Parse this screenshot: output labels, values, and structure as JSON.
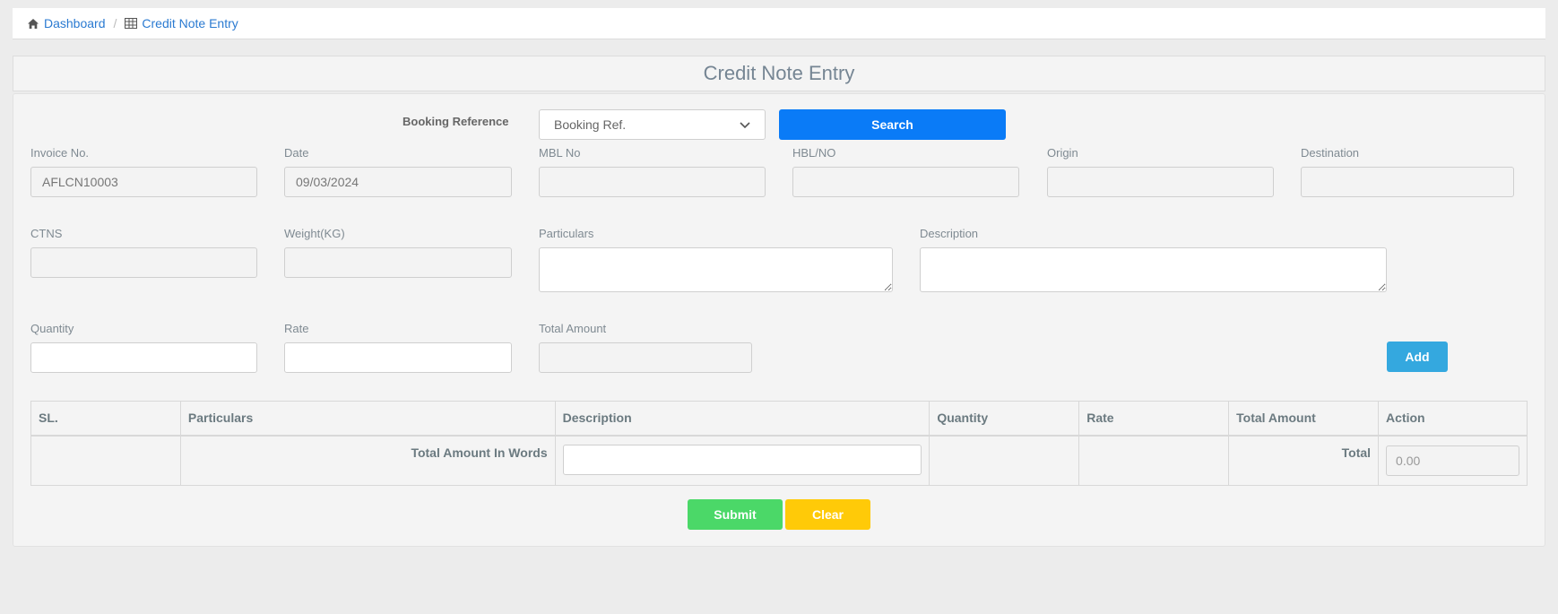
{
  "breadcrumb": {
    "home_label": "Dashboard",
    "home_icon": "home-icon",
    "current_label": "Credit Note Entry",
    "current_icon": "table-icon"
  },
  "page": {
    "title": "Credit Note Entry"
  },
  "form": {
    "booking_reference_label": "Booking Reference",
    "booking_reference_value": "Booking Ref.",
    "search_label": "Search",
    "invoice_no_label": "Invoice No.",
    "invoice_no_value": "AFLCN10003",
    "date_label": "Date",
    "date_value": "09/03/2024",
    "mbl_label": "MBL No",
    "hbl_label": "HBL/NO",
    "origin_label": "Origin",
    "destination_label": "Destination",
    "ctns_label": "CTNS",
    "weight_label": "Weight(KG)",
    "particulars_label": "Particulars",
    "description_label": "Description",
    "quantity_label": "Quantity",
    "rate_label": "Rate",
    "total_amount_label": "Total Amount",
    "add_label": "Add"
  },
  "table": {
    "headers": [
      "SL.",
      "Particulars",
      "Description",
      "Quantity",
      "Rate",
      "Total Amount",
      "Action"
    ],
    "total_in_words_label": "Total Amount In Words",
    "total_label": "Total",
    "total_value": "0.00"
  },
  "actions": {
    "submit_label": "Submit",
    "clear_label": "Clear"
  },
  "colors": {
    "search_button": "#0a7bf7",
    "add_button": "#34a8df",
    "submit_button": "#4bd868",
    "clear_button": "#ffca08",
    "link": "#2a7ad1"
  }
}
